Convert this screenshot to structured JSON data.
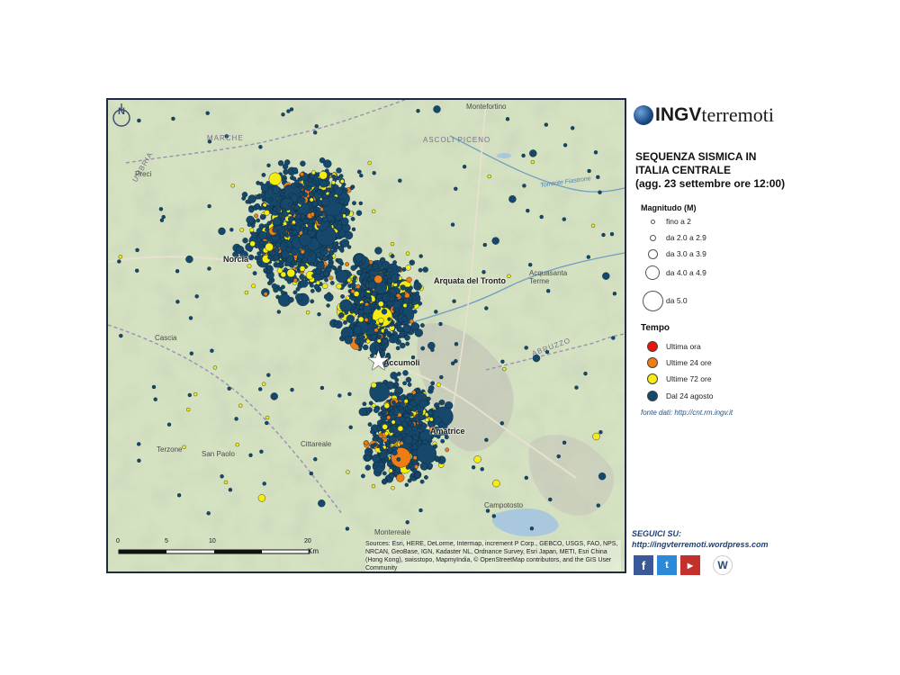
{
  "header": {
    "brand_bold": "INGV",
    "brand_light": "terremoti",
    "title_line1": "SEQUENZA SISMICA IN",
    "title_line2": "ITALIA CENTRALE",
    "title_line3": "(agg. 23 settembre ore 12:00)"
  },
  "legend": {
    "magnitude_title": "Magnitudo (M)",
    "magnitude_classes": [
      "fino a 2",
      "da 2.0 a 2.9",
      "da 3.0 a 3.9",
      "da 4.0 a 4.9",
      "da 5.0"
    ],
    "time_title": "Tempo",
    "time_classes": [
      {
        "label": "Ultima ora",
        "color": "#e8150f"
      },
      {
        "label": "Ultime 24 ore",
        "color": "#f07d14"
      },
      {
        "label": "Ultime 72 ore",
        "color": "#f5ec12"
      },
      {
        "label": "Dal 24 agosto",
        "color": "#15486b"
      }
    ],
    "source": "fonte dati: http://cnt.rm.ingv.it"
  },
  "follow": {
    "line1": "SEGUICI SU:",
    "line2": "http://ingvterremoti.wordpress.com",
    "networks": [
      "facebook-icon",
      "twitter-icon",
      "youtube-icon",
      "wordpress-icon"
    ]
  },
  "map": {
    "epicenter_label": "Accumoli",
    "towns": {
      "norcia": "Norcia",
      "arquata": "Arquata del Tronto",
      "amatrice": "Amatrice",
      "montefortino": "Montefortino",
      "acquasanta": "Acquasanta Terme",
      "campotosto": "Campotosto",
      "cascia": "Cascia",
      "terzone": "Terzone",
      "sanpaolo": "San Paolo",
      "preci": "Preci",
      "montereale": "Montereale",
      "cittareale": "Cittareale"
    },
    "regions": {
      "marche": "MARCHE",
      "umbria": "UMBRIA",
      "abruzzo": "ABRUZZO",
      "ascoli": "ASCOLI PICENO"
    },
    "rivers": {
      "fiastrone": "Torrente Fiastrone",
      "tronto": "Fiume Tronto"
    },
    "scale": {
      "ticks": [
        "0",
        "5",
        "10",
        "20"
      ],
      "unit": "Km"
    },
    "north": "N",
    "attribution": "Sources: Esri, HERE, DeLorme, Intermap, increment P Corp., GEBCO, USGS, FAO, NPS, NRCAN, GeoBase, IGN, Kadaster NL, Ordnance Survey, Esri Japan, METI, Esri China (Hong Kong), swisstopo, MapmyIndia, © OpenStreetMap contributors, and the GIS User Community",
    "epicenter": {
      "lat_label": "",
      "magnitude": 6.0
    },
    "colors": {
      "land": "#d8e4c4",
      "relief": "#b9c8a3",
      "quake_blue": "#15486b",
      "quake_yellow": "#f5ec12",
      "quake_orange": "#f07d14",
      "lake": "#a9c8de"
    }
  }
}
